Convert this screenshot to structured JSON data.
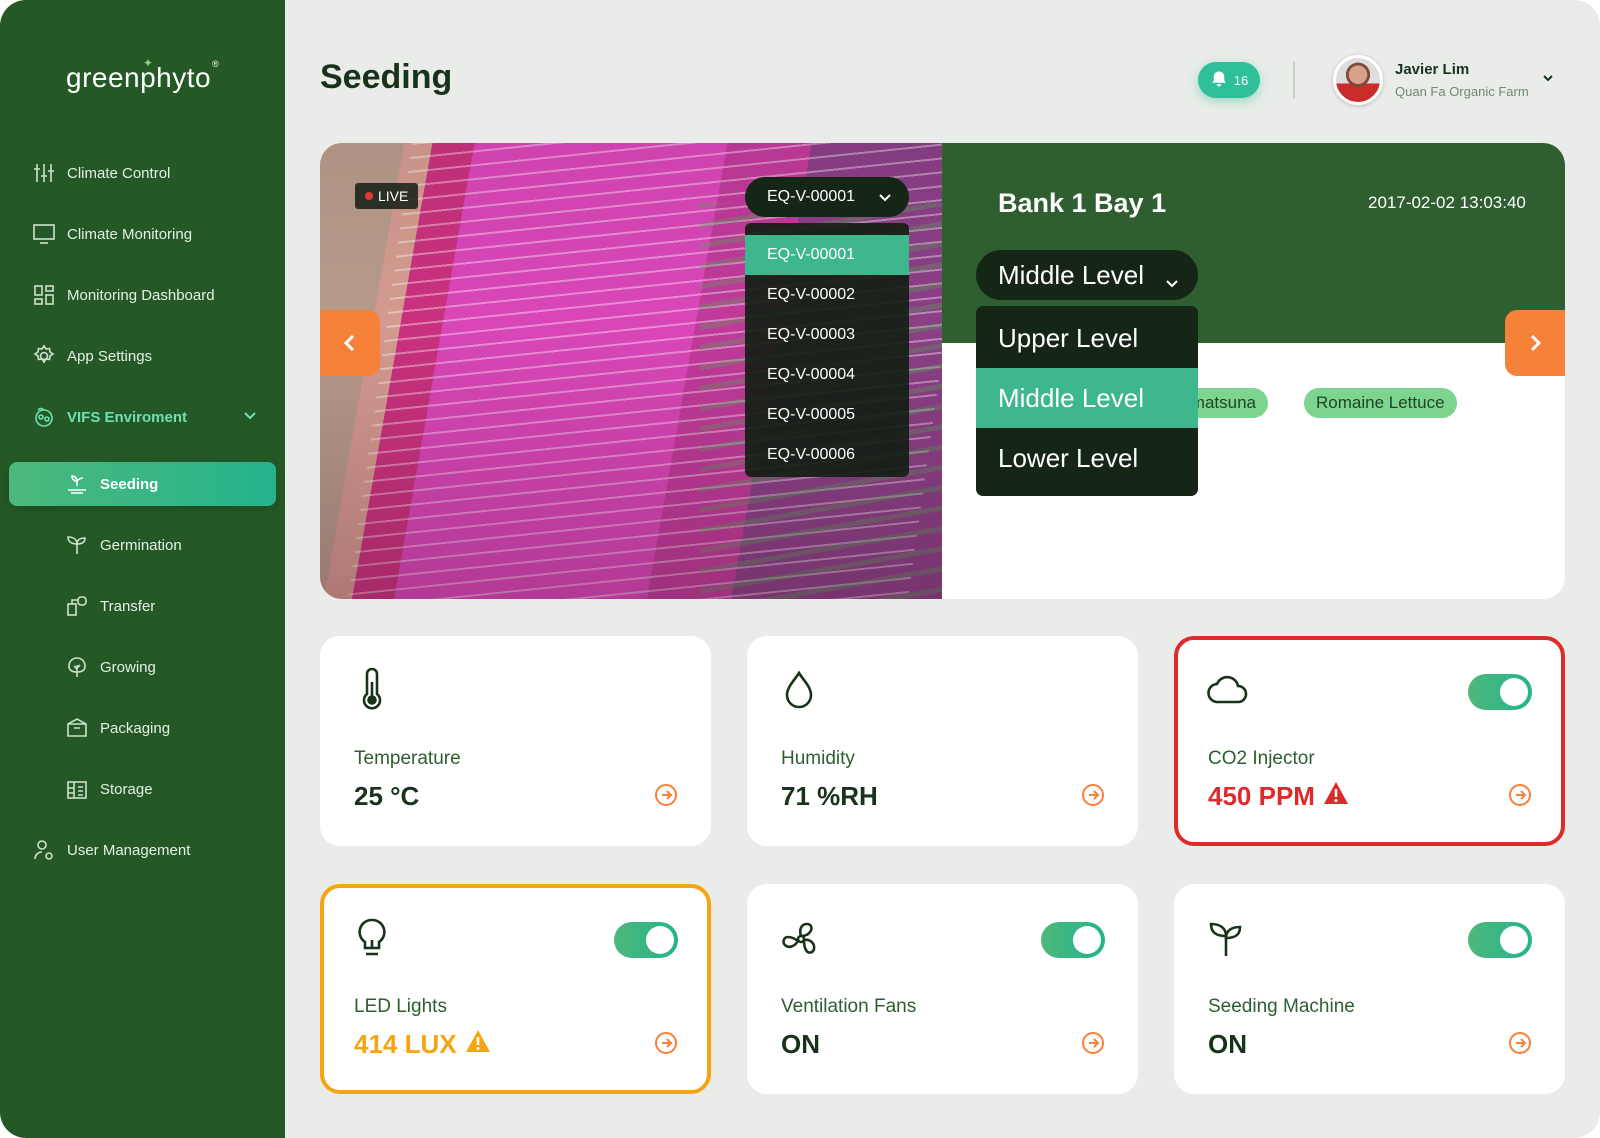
{
  "brand": {
    "name": "greenphyto",
    "reg": "®"
  },
  "sidebar": {
    "items": [
      {
        "label": "Climate Control",
        "icon": "sliders-icon"
      },
      {
        "label": "Climate Monitoring",
        "icon": "monitor-icon"
      },
      {
        "label": "Monitoring Dashboard",
        "icon": "dashboard-icon"
      },
      {
        "label": "App Settings",
        "icon": "gear-icon"
      },
      {
        "label": "VIFS Enviroment",
        "icon": "vifs-icon"
      }
    ],
    "subitems": [
      {
        "label": "Seeding",
        "icon": "seeding-icon",
        "active": true
      },
      {
        "label": "Germination",
        "icon": "sprout-icon"
      },
      {
        "label": "Transfer",
        "icon": "transfer-icon"
      },
      {
        "label": "Growing",
        "icon": "tree-icon"
      },
      {
        "label": "Packaging",
        "icon": "box-icon"
      },
      {
        "label": "Storage",
        "icon": "storage-icon"
      }
    ],
    "footer_item": {
      "label": "User Management",
      "icon": "user-gear-icon"
    }
  },
  "header": {
    "title": "Seeding",
    "notifications": "16",
    "user": {
      "name": "Javier Lim",
      "farm": "Quan Fa Organic Farm"
    }
  },
  "camera": {
    "live_label": "LIVE",
    "selected_equipment": "EQ-V-00001",
    "equipment_options": [
      "EQ-V-00001",
      "EQ-V-00002",
      "EQ-V-00003",
      "EQ-V-00004",
      "EQ-V-00005",
      "EQ-V-00006"
    ]
  },
  "bay": {
    "title": "Bank 1 Bay 1",
    "datetime": "2017-02-02 13:03:40",
    "selected_level": "Middle Level",
    "level_options": [
      "Upper Level",
      "Middle Level",
      "Lower Level"
    ],
    "crops": [
      "Komatsuna",
      "Romaine Lettuce"
    ]
  },
  "sensors": [
    {
      "label": "Temperature",
      "value": "25 °C",
      "icon": "thermometer-icon",
      "status": "normal",
      "toggle": false
    },
    {
      "label": "Humidity",
      "value": "71 %RH",
      "icon": "droplet-icon",
      "status": "normal",
      "toggle": false
    },
    {
      "label": "CO2 Injector",
      "value": "450 PPM",
      "icon": "cloud-icon",
      "status": "alert",
      "toggle": true,
      "toggle_on": true
    },
    {
      "label": "LED Lights",
      "value": "414 LUX",
      "icon": "bulb-icon",
      "status": "warning",
      "toggle": true,
      "toggle_on": true
    },
    {
      "label": "Ventilation Fans",
      "value": "ON",
      "icon": "fan-icon",
      "status": "normal",
      "toggle": true,
      "toggle_on": true
    },
    {
      "label": "Seeding Machine",
      "value": "ON",
      "icon": "plant-icon",
      "status": "normal",
      "toggle": true,
      "toggle_on": true
    }
  ],
  "colors": {
    "sidebar": "#245927",
    "accent": "#2fc09a",
    "orange": "#f6823a",
    "alert": "#dd2a2a",
    "warning": "#f6a512"
  }
}
